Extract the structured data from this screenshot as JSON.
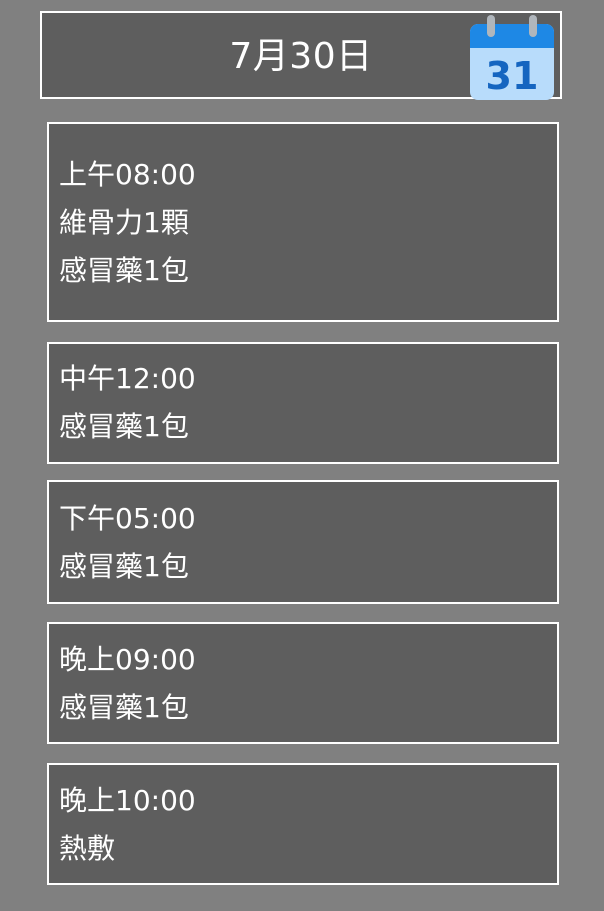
{
  "header": {
    "date": "7月30日",
    "calendar_icon": "calendar-icon",
    "calendar_day": "31",
    "colors": {
      "calendar_body": "#b8dcfb",
      "calendar_top": "#1e88e5",
      "calendar_text": "#1565c0"
    }
  },
  "schedule": [
    {
      "time": "上午08:00",
      "items": [
        "維骨力1顆",
        "感冒藥1包"
      ]
    },
    {
      "time": "中午12:00",
      "items": [
        "感冒藥1包"
      ]
    },
    {
      "time": "下午05:00",
      "items": [
        "感冒藥1包"
      ]
    },
    {
      "time": "晚上09:00",
      "items": [
        "感冒藥1包"
      ]
    },
    {
      "time": "晚上10:00",
      "items": [
        "熱敷"
      ]
    }
  ]
}
